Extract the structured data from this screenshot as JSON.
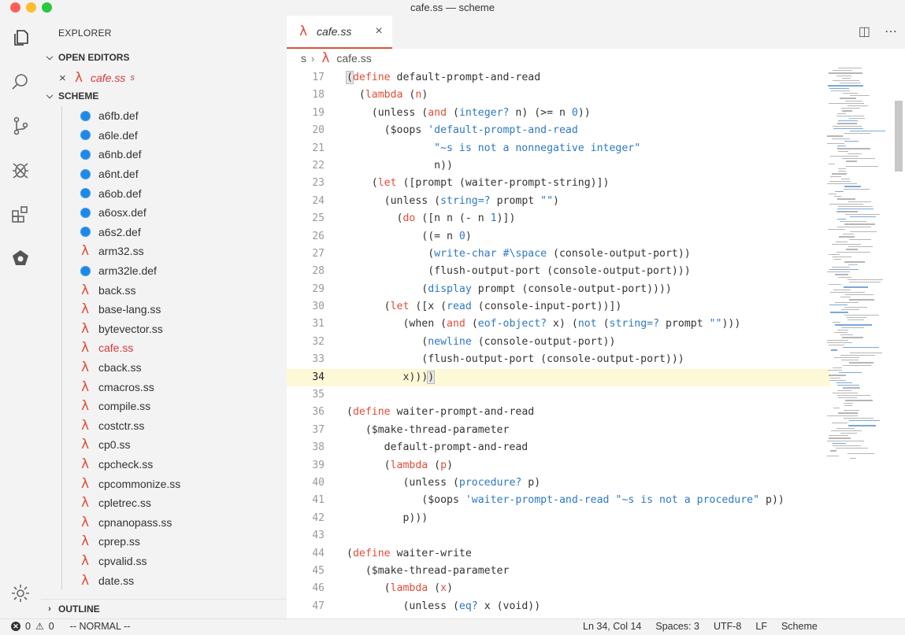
{
  "window": {
    "title": "cafe.ss — scheme"
  },
  "activity_icons": [
    "files-icon",
    "search-icon",
    "source-control-icon",
    "debug-icon",
    "extensions-icon",
    "remote-icon",
    "gear-icon"
  ],
  "sidebar": {
    "title": "EXPLORER",
    "open_editors_label": "OPEN EDITORS",
    "open_editor": {
      "name": "cafe.ss",
      "dir": "s"
    },
    "folder_label": "SCHEME",
    "outline_label": "OUTLINE",
    "files": [
      {
        "name": "a6fb.def",
        "icon": "def-icon"
      },
      {
        "name": "a6le.def",
        "icon": "def-icon"
      },
      {
        "name": "a6nb.def",
        "icon": "def-icon"
      },
      {
        "name": "a6nt.def",
        "icon": "def-icon"
      },
      {
        "name": "a6ob.def",
        "icon": "def-icon"
      },
      {
        "name": "a6osx.def",
        "icon": "def-icon"
      },
      {
        "name": "a6s2.def",
        "icon": "def-icon"
      },
      {
        "name": "arm32.ss",
        "icon": "lambda-icon"
      },
      {
        "name": "arm32le.def",
        "icon": "def-icon"
      },
      {
        "name": "back.ss",
        "icon": "lambda-icon"
      },
      {
        "name": "base-lang.ss",
        "icon": "lambda-icon"
      },
      {
        "name": "bytevector.ss",
        "icon": "lambda-icon"
      },
      {
        "name": "cafe.ss",
        "icon": "lambda-icon",
        "active": true
      },
      {
        "name": "cback.ss",
        "icon": "lambda-icon"
      },
      {
        "name": "cmacros.ss",
        "icon": "lambda-icon"
      },
      {
        "name": "compile.ss",
        "icon": "lambda-icon"
      },
      {
        "name": "costctr.ss",
        "icon": "lambda-icon"
      },
      {
        "name": "cp0.ss",
        "icon": "lambda-icon"
      },
      {
        "name": "cpcheck.ss",
        "icon": "lambda-icon"
      },
      {
        "name": "cpcommonize.ss",
        "icon": "lambda-icon"
      },
      {
        "name": "cpletrec.ss",
        "icon": "lambda-icon"
      },
      {
        "name": "cpnanopass.ss",
        "icon": "lambda-icon"
      },
      {
        "name": "cprep.ss",
        "icon": "lambda-icon"
      },
      {
        "name": "cpvalid.ss",
        "icon": "lambda-icon"
      },
      {
        "name": "date.ss",
        "icon": "lambda-icon"
      }
    ]
  },
  "editor": {
    "tab_name": "cafe.ss",
    "breadcrumb_dir": "s",
    "breadcrumb_file": "cafe.ss",
    "current_line": 34,
    "lines": [
      {
        "n": "17",
        "tokens": [
          [
            "(",
            "open"
          ],
          [
            "define",
            "kw"
          ],
          [
            " default-prompt-and-read",
            ""
          ]
        ]
      },
      {
        "n": "18",
        "tokens": [
          [
            "  (",
            ""
          ],
          [
            "lambda",
            "kw"
          ],
          [
            " (",
            ""
          ],
          [
            "n",
            "kw"
          ],
          [
            ")",
            ""
          ]
        ]
      },
      {
        "n": "19",
        "tokens": [
          [
            "    (unless (",
            ""
          ],
          [
            "and",
            "kw"
          ],
          [
            " (",
            ""
          ],
          [
            "integer?",
            "bi"
          ],
          [
            " n) (>= n ",
            ""
          ],
          [
            "0",
            "bi"
          ],
          [
            "))",
            ""
          ]
        ]
      },
      {
        "n": "20",
        "tokens": [
          [
            "      ($oops ",
            ""
          ],
          [
            "'default-prompt-and-read",
            "str"
          ]
        ]
      },
      {
        "n": "21",
        "tokens": [
          [
            "              ",
            ""
          ],
          [
            "\"~s is not a nonnegative integer\"",
            "str"
          ]
        ]
      },
      {
        "n": "22",
        "tokens": [
          [
            "              n))",
            ""
          ]
        ]
      },
      {
        "n": "23",
        "tokens": [
          [
            "    (",
            ""
          ],
          [
            "let",
            "kw"
          ],
          [
            " ([prompt (waiter-prompt-string)])",
            ""
          ]
        ]
      },
      {
        "n": "24",
        "tokens": [
          [
            "      (unless (",
            ""
          ],
          [
            "string=?",
            "bi"
          ],
          [
            " prompt ",
            ""
          ],
          [
            "\"\"",
            "str"
          ],
          [
            ")",
            ""
          ]
        ]
      },
      {
        "n": "25",
        "tokens": [
          [
            "        (",
            ""
          ],
          [
            "do",
            "kw"
          ],
          [
            " ([n n (- n ",
            ""
          ],
          [
            "1",
            "bi"
          ],
          [
            ")])",
            ""
          ]
        ]
      },
      {
        "n": "26",
        "tokens": [
          [
            "            ((= n ",
            ""
          ],
          [
            "0",
            "bi"
          ],
          [
            ")",
            ""
          ]
        ]
      },
      {
        "n": "27",
        "tokens": [
          [
            "             (",
            ""
          ],
          [
            "write-char",
            "bi"
          ],
          [
            " ",
            ""
          ],
          [
            "#\\space",
            "bi"
          ],
          [
            " (console-output-port))",
            ""
          ]
        ]
      },
      {
        "n": "28",
        "tokens": [
          [
            "             (flush-output-port (console-output-port)))",
            ""
          ]
        ]
      },
      {
        "n": "29",
        "tokens": [
          [
            "            (",
            ""
          ],
          [
            "display",
            "bi"
          ],
          [
            " prompt (console-output-port))))",
            ""
          ]
        ]
      },
      {
        "n": "30",
        "tokens": [
          [
            "      (",
            ""
          ],
          [
            "let",
            "kw"
          ],
          [
            " ([x (",
            ""
          ],
          [
            "read",
            "bi"
          ],
          [
            " (console-input-port))])",
            ""
          ]
        ]
      },
      {
        "n": "31",
        "tokens": [
          [
            "         (when (",
            ""
          ],
          [
            "and",
            "kw"
          ],
          [
            " (",
            ""
          ],
          [
            "eof-object?",
            "bi"
          ],
          [
            " x) (",
            ""
          ],
          [
            "not",
            "bi"
          ],
          [
            " (",
            ""
          ],
          [
            "string=?",
            "bi"
          ],
          [
            " prompt ",
            ""
          ],
          [
            "\"\"",
            "str"
          ],
          [
            ")))",
            ""
          ]
        ]
      },
      {
        "n": "32",
        "tokens": [
          [
            "            (",
            ""
          ],
          [
            "newline",
            "bi"
          ],
          [
            " (console-output-port))",
            ""
          ]
        ]
      },
      {
        "n": "33",
        "tokens": [
          [
            "            (flush-output-port (console-output-port)))",
            ""
          ]
        ]
      },
      {
        "n": "34",
        "tokens": [
          [
            "         x)))",
            ""
          ],
          [
            ")",
            "cur"
          ]
        ]
      },
      {
        "n": "35",
        "tokens": [
          [
            "",
            ""
          ]
        ]
      },
      {
        "n": "36",
        "tokens": [
          [
            "(",
            ""
          ],
          [
            "define",
            "kw"
          ],
          [
            " waiter-prompt-and-read",
            ""
          ]
        ]
      },
      {
        "n": "37",
        "tokens": [
          [
            "   ($make-thread-parameter",
            ""
          ]
        ]
      },
      {
        "n": "38",
        "tokens": [
          [
            "      default-prompt-and-read",
            ""
          ]
        ]
      },
      {
        "n": "39",
        "tokens": [
          [
            "      (",
            ""
          ],
          [
            "lambda",
            "kw"
          ],
          [
            " (",
            ""
          ],
          [
            "p",
            "kw"
          ],
          [
            ")",
            ""
          ]
        ]
      },
      {
        "n": "40",
        "tokens": [
          [
            "         (unless (",
            ""
          ],
          [
            "procedure?",
            "bi"
          ],
          [
            " p)",
            ""
          ]
        ]
      },
      {
        "n": "41",
        "tokens": [
          [
            "            ($oops ",
            ""
          ],
          [
            "'waiter-prompt-and-read",
            "str"
          ],
          [
            " ",
            ""
          ],
          [
            "\"~s is not a procedure\"",
            "str"
          ],
          [
            " p))",
            ""
          ]
        ]
      },
      {
        "n": "42",
        "tokens": [
          [
            "         p)))",
            ""
          ]
        ]
      },
      {
        "n": "43",
        "tokens": [
          [
            "",
            ""
          ]
        ]
      },
      {
        "n": "44",
        "tokens": [
          [
            "(",
            ""
          ],
          [
            "define",
            "kw"
          ],
          [
            " waiter-write",
            ""
          ]
        ]
      },
      {
        "n": "45",
        "tokens": [
          [
            "   ($make-thread-parameter",
            ""
          ]
        ]
      },
      {
        "n": "46",
        "tokens": [
          [
            "      (",
            ""
          ],
          [
            "lambda",
            "kw"
          ],
          [
            " (",
            ""
          ],
          [
            "x",
            "kw"
          ],
          [
            ")",
            ""
          ]
        ]
      },
      {
        "n": "47",
        "tokens": [
          [
            "         (unless (",
            ""
          ],
          [
            "eq?",
            "bi"
          ],
          [
            " x (void))",
            ""
          ]
        ]
      }
    ]
  },
  "statusbar": {
    "errors": "0",
    "warnings": "0",
    "mode": "-- NORMAL --",
    "position": "Ln 34, Col 14",
    "spaces": "Spaces: 3",
    "encoding": "UTF-8",
    "eol": "LF",
    "language": "Scheme"
  },
  "colors": {
    "accent": "#e04e39",
    "keyword": "#e04e39",
    "builtin": "#2f78c4",
    "def_icon": "#1e88e5"
  }
}
